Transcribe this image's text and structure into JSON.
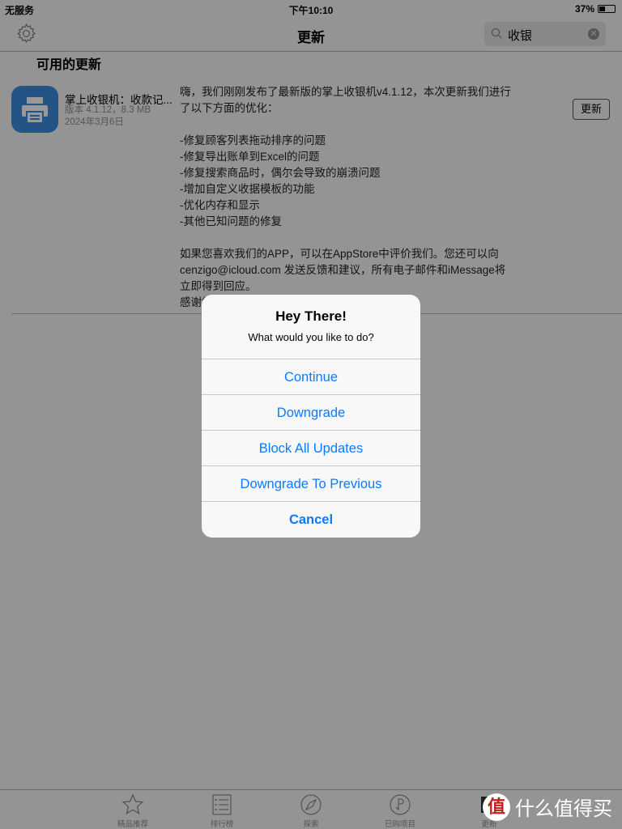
{
  "status": {
    "carrier": "无服务",
    "time": "下午10:10",
    "battery": "37%"
  },
  "nav": {
    "title": "更新",
    "search_value": "收银"
  },
  "section_title": "可用的更新",
  "app": {
    "name": "掌上收银机：收款记...",
    "version": "版本 4.1.12，8.3 MB",
    "date": "2024年3月6日",
    "update_label": "更新",
    "icon_color": "#3d8ae0"
  },
  "notes": {
    "intro": "嗨，我们刚刚发布了最新版的掌上收银机v4.1.12，本次更新我们进行了以下方面的优化：",
    "items": [
      "-修复顾客列表拖动排序的问题",
      "-修复导出账单到Excel的问题",
      "-修复搜索商品时，偶尔会导致的崩溃问题",
      "-增加自定义收据模板的功能",
      "-优化内存和显示",
      "-其他已知问题的修复"
    ],
    "outro": "如果您喜欢我们的APP，可以在AppStore中评价我们。您还可以向 cenzigo@icloud.com 发送反馈和建议，所有电子邮件和iMessage将立即得到回应。",
    "thanks": "感谢您一直以来的支持，使用我们的应用程序。"
  },
  "tabs": [
    {
      "label": "精品推荐",
      "icon": "star-icon"
    },
    {
      "label": "排行榜",
      "icon": "list-icon"
    },
    {
      "label": "探索",
      "icon": "compass-icon"
    },
    {
      "label": "已购项目",
      "icon": "purchased-icon"
    },
    {
      "label": "更新",
      "icon": "update-icon"
    }
  ],
  "alert": {
    "title": "Hey There!",
    "message": "What would you like to do?",
    "buttons": [
      "Continue",
      "Downgrade",
      "Block All Updates",
      "Downgrade To Previous",
      "Cancel"
    ],
    "accent": "#0a7aff"
  },
  "watermark": {
    "badge": "值",
    "text": "什么值得买"
  }
}
